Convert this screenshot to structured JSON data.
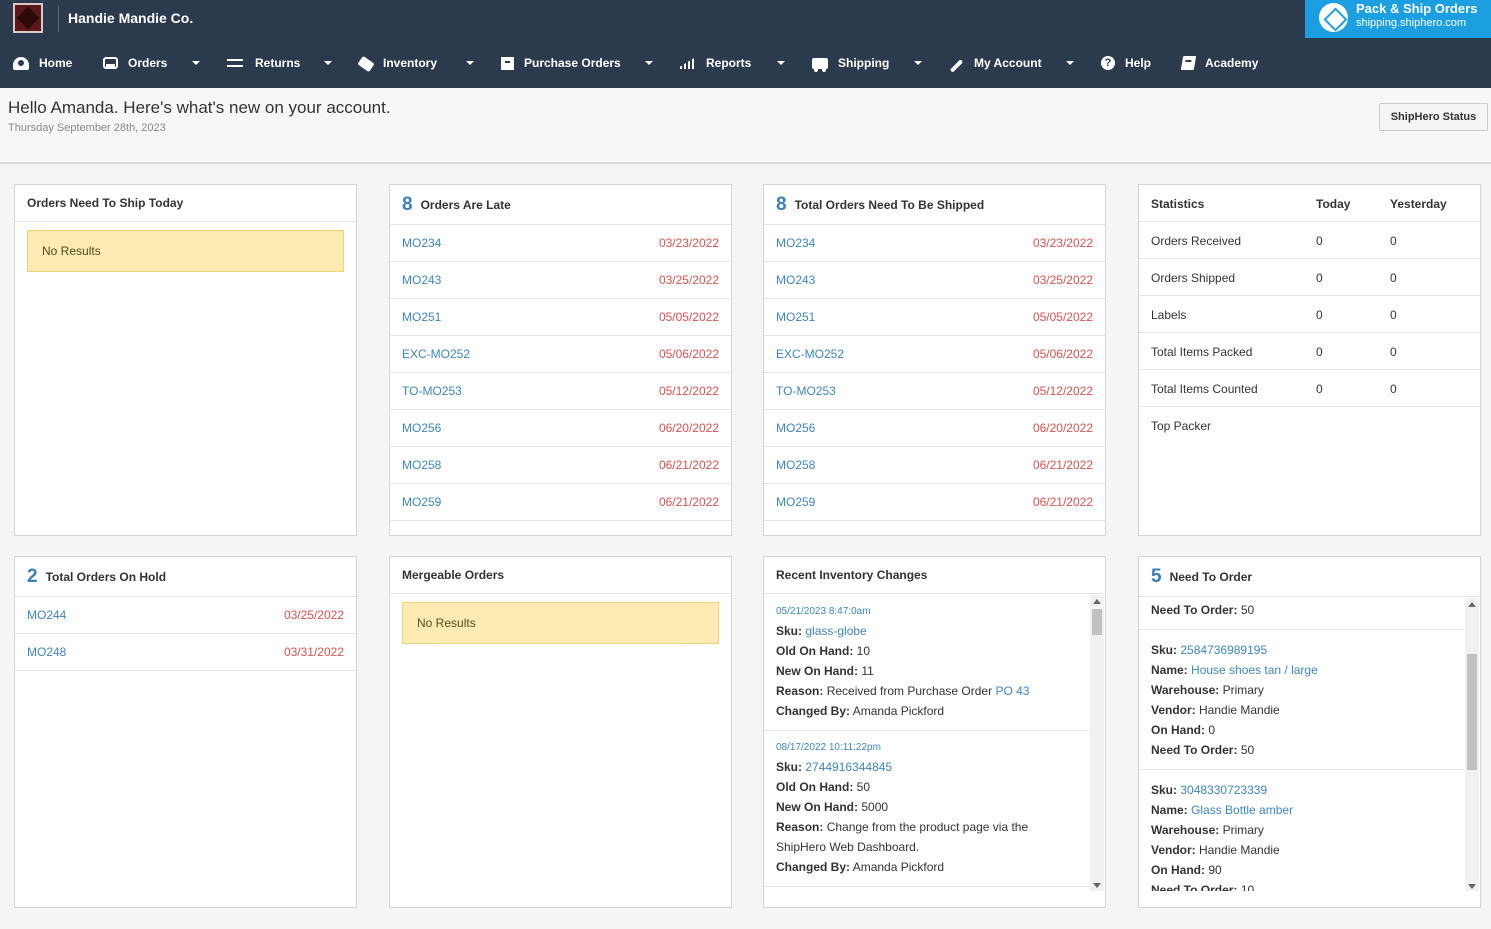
{
  "app": {
    "company": "Handie Mandie Co."
  },
  "pack_ship": {
    "title": "Pack & Ship Orders",
    "url": "shipping.shiphero.com"
  },
  "nav": [
    {
      "label": "Home",
      "icon": "home-icon",
      "dropdown": false
    },
    {
      "label": "Orders",
      "icon": "inbox-icon",
      "dropdown": true
    },
    {
      "label": "Returns",
      "icon": "exchange-icon",
      "dropdown": true
    },
    {
      "label": "Inventory",
      "icon": "tags-icon",
      "dropdown": true
    },
    {
      "label": "Purchase Orders",
      "icon": "archive-icon",
      "dropdown": true
    },
    {
      "label": "Reports",
      "icon": "signal-icon",
      "dropdown": true
    },
    {
      "label": "Shipping",
      "icon": "truck-icon",
      "dropdown": true
    },
    {
      "label": "My Account",
      "icon": "wrench-icon",
      "dropdown": true
    },
    {
      "label": "Help",
      "icon": "question-icon",
      "dropdown": false
    },
    {
      "label": "Academy",
      "icon": "book-icon",
      "dropdown": false
    }
  ],
  "welcome": {
    "greeting": "Hello Amanda. Here's what's new on your account.",
    "date": "Thursday September 28th, 2023",
    "status_button": "ShipHero Status"
  },
  "ship_today": {
    "title": "Orders Need To Ship Today",
    "empty": "No Results"
  },
  "late": {
    "count": "8",
    "title": "Orders Are Late",
    "rows": [
      {
        "order": "MO234",
        "date": "03/23/2022"
      },
      {
        "order": "MO243",
        "date": "03/25/2022"
      },
      {
        "order": "MO251",
        "date": "05/05/2022"
      },
      {
        "order": "EXC-MO252",
        "date": "05/06/2022"
      },
      {
        "order": "TO-MO253",
        "date": "05/12/2022"
      },
      {
        "order": "MO256",
        "date": "06/20/2022"
      },
      {
        "order": "MO258",
        "date": "06/21/2022"
      },
      {
        "order": "MO259",
        "date": "06/21/2022"
      }
    ]
  },
  "to_ship": {
    "count": "8",
    "title": "Total Orders Need To Be Shipped",
    "rows": [
      {
        "order": "MO234",
        "date": "03/23/2022"
      },
      {
        "order": "MO243",
        "date": "03/25/2022"
      },
      {
        "order": "MO251",
        "date": "05/05/2022"
      },
      {
        "order": "EXC-MO252",
        "date": "05/06/2022"
      },
      {
        "order": "TO-MO253",
        "date": "05/12/2022"
      },
      {
        "order": "MO256",
        "date": "06/20/2022"
      },
      {
        "order": "MO258",
        "date": "06/21/2022"
      },
      {
        "order": "MO259",
        "date": "06/21/2022"
      }
    ]
  },
  "stats": {
    "headers": [
      "Statistics",
      "Today",
      "Yesterday"
    ],
    "rows": [
      {
        "label": "Orders Received",
        "today": "0",
        "yesterday": "0"
      },
      {
        "label": "Orders Shipped",
        "today": "0",
        "yesterday": "0"
      },
      {
        "label": "Labels",
        "today": "0",
        "yesterday": "0"
      },
      {
        "label": "Total Items Packed",
        "today": "0",
        "yesterday": "0"
      },
      {
        "label": "Total Items Counted",
        "today": "0",
        "yesterday": "0"
      }
    ],
    "top_packer": "Top Packer"
  },
  "on_hold": {
    "count": "2",
    "title": "Total Orders On Hold",
    "rows": [
      {
        "order": "MO244",
        "date": "03/25/2022"
      },
      {
        "order": "MO248",
        "date": "03/31/2022"
      }
    ]
  },
  "mergeable": {
    "title": "Mergeable Orders",
    "empty": "No Results"
  },
  "inventory_changes": {
    "title": "Recent Inventory Changes",
    "labels": {
      "sku": "Sku:",
      "old": "Old On Hand:",
      "new": "New On Hand:",
      "reason": "Reason:",
      "changed_by": "Changed By:"
    },
    "entries": [
      {
        "timestamp": "05/21/2023 8:47:0am",
        "sku": "glass-globe",
        "old": "10",
        "new": "11",
        "reason": "Received from Purchase Order",
        "reason_link": "PO 43",
        "changed_by": "Amanda Pickford"
      },
      {
        "timestamp": "08/17/2022 10:11:22pm",
        "sku": "2744916344845",
        "old": "50",
        "new": "5000",
        "reason": "Change from the product page via the ShipHero Web Dashboard.",
        "reason_link": "",
        "changed_by": "Amanda Pickford"
      }
    ]
  },
  "need_to_order": {
    "count": "5",
    "title": "Need To Order",
    "labels": {
      "sku": "Sku:",
      "name": "Name:",
      "warehouse": "Warehouse:",
      "vendor": "Vendor:",
      "on_hand": "On Hand:",
      "need": "Need To Order:"
    },
    "partial": {
      "on_hand": "0",
      "need": "50"
    },
    "items": [
      {
        "sku": "2584736989195",
        "name": "House shoes tan / large",
        "warehouse": "Primary",
        "vendor": "Handie Mandie",
        "on_hand": "0",
        "need": "50"
      },
      {
        "sku": "3048330723339",
        "name": "Glass Bottle amber",
        "warehouse": "Primary",
        "vendor": "Handie Mandie",
        "on_hand": "90",
        "need": "10"
      }
    ]
  }
}
